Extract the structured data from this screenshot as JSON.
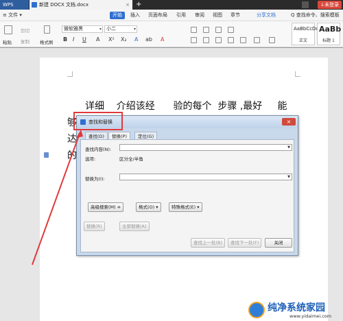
{
  "titlebar": {
    "app_tab": "WPS",
    "doc_tab": "新建 DOCX 文档.docx",
    "doc_close": "×",
    "new_tab": "+",
    "login": "↓未登录"
  },
  "menubar": {
    "file": "≡ 文件 ▾",
    "items": [
      "开始",
      "插入",
      "页面布局",
      "引用",
      "审阅",
      "视图",
      "章节"
    ],
    "share": "分享文档",
    "search": "Q 查找命令、搜索模板"
  },
  "ribbon": {
    "paste": "粘贴",
    "cut": "剪切",
    "copy": "复制",
    "format_painter": "格式刷",
    "font_name": "微软雅黑",
    "font_size": "小二",
    "format_buttons": [
      "B",
      "I",
      "U",
      "A",
      "X²",
      "X₂",
      "A",
      "ab",
      "A"
    ],
    "styles": [
      {
        "sample": "AaBbCcDd",
        "name": "正文"
      },
      {
        "sample": "AaBb",
        "name": "标题 1"
      }
    ]
  },
  "document": {
    "lines": [
      "详细    介绍该经      验的每个  步骤 ,最好     能",
      "够",
      "达",
      "的"
    ]
  },
  "dialog": {
    "title": "查找和替换",
    "close": "×",
    "tabs": [
      "查找(D)",
      "替换(P)",
      "定位(G)"
    ],
    "find_label": "查找内容(N):",
    "options_label": "选项:",
    "options_value": "区分全/半角",
    "replace_label": "替换为(I):",
    "advanced": "高级搜索(M) ≑",
    "format": "格式(O) ▾",
    "special": "特殊格式(E) ▾",
    "replace": "替换(R)",
    "replace_all": "全部替换(A)",
    "find_prev": "查找上一处(B)",
    "find_next": "查找下一处(F)",
    "close_btn": "关闭"
  },
  "watermark": {
    "title": "纯净系统家园",
    "url": "www.yidaimei.com"
  },
  "colors": {
    "accent": "#2f6fd0",
    "highlight": "#e0393b"
  }
}
